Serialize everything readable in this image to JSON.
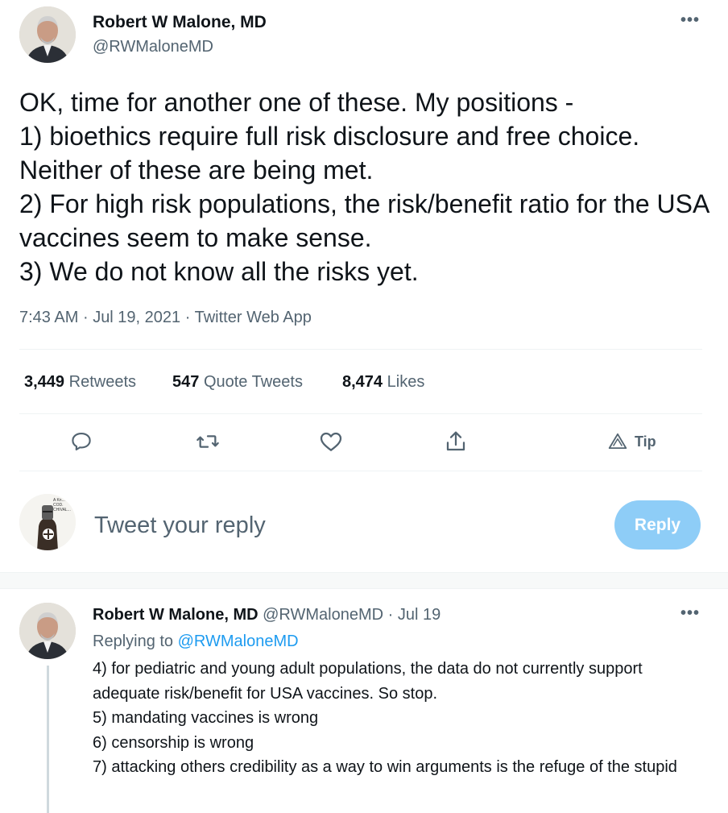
{
  "main_tweet": {
    "author_name": "Robert W Malone, MD",
    "author_handle": "@RWMaloneMD",
    "more_label": "•••",
    "text": "OK, time for another one of these.  My positions -\n1) bioethics require full risk disclosure and free choice.  Neither of these are being met.\n2) For high risk populations, the risk/benefit ratio for the USA vaccines seem to make sense.\n3) We do not know all the risks yet.",
    "time": "7:43 AM",
    "date": "Jul 19, 2021",
    "source": "Twitter Web App",
    "sep": "·"
  },
  "stats": {
    "retweets_count": "3,449",
    "retweets_label": "Retweets",
    "quotes_count": "547",
    "quotes_label": "Quote Tweets",
    "likes_count": "8,474",
    "likes_label": "Likes"
  },
  "actions": {
    "tip_label": "Tip",
    "icons": [
      "reply-icon",
      "retweet-icon",
      "like-icon",
      "share-icon",
      "tip-icon"
    ]
  },
  "composer": {
    "placeholder": "Tweet your reply",
    "reply_label": "Reply",
    "avatar_caption": "A Kn... COD. CHIVAL..."
  },
  "reply_tweet": {
    "author_name": "Robert W Malone, MD",
    "author_handle": "@RWMaloneMD",
    "sep": "·",
    "date": "Jul 19",
    "more_label": "•••",
    "replying_prefix": "Replying to",
    "replying_handle": "@RWMaloneMD",
    "text": "4) for pediatric and young adult populations, the data do not currently support adequate risk/benefit for USA vaccines.  So stop.\n5) mandating vaccines is wrong\n6) censorship is wrong\n7) attacking others credibility as a way to win arguments is the refuge of the stupid"
  },
  "colors": {
    "accent": "#1d9bf0",
    "reply_button": "#8ecdf7",
    "secondary_text": "#536471",
    "divider": "#eff3f4"
  }
}
